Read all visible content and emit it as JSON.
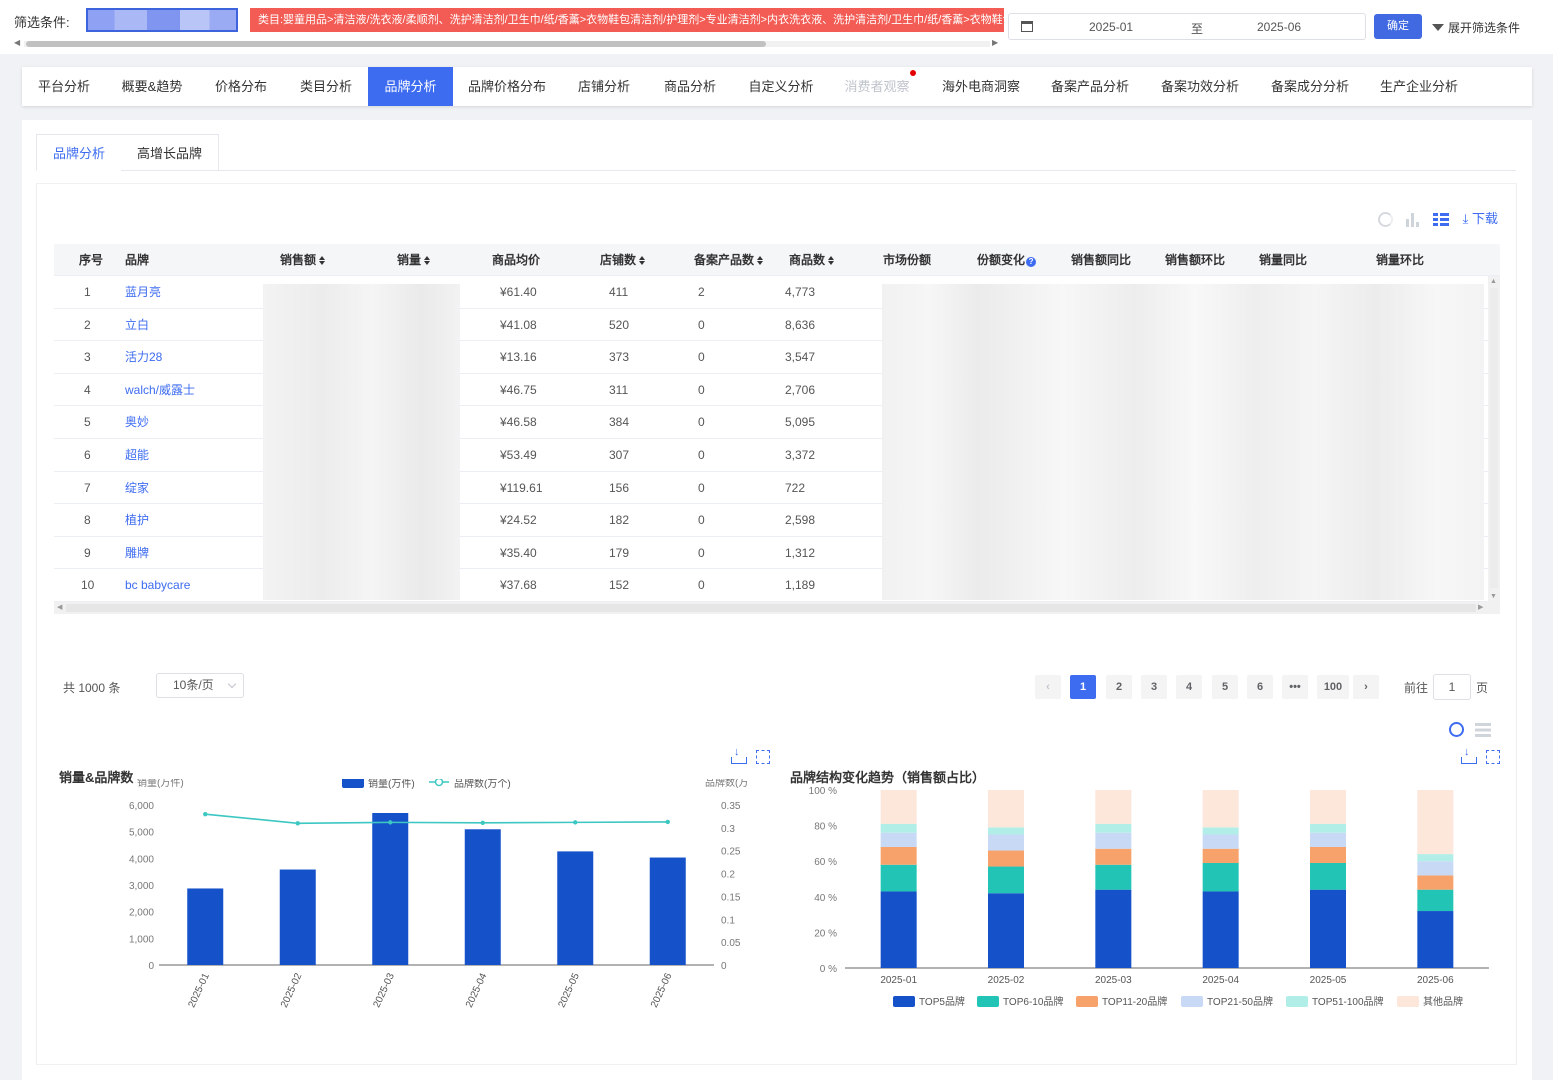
{
  "filter": {
    "label": "筛选条件:",
    "category_path": "类目:婴童用品>清洁液/洗衣液/柔顺剂、洗护清洁剂/卫生巾/纸/香薰>衣物鞋包清洁剂/护理剂>专业清洁剂>内衣洗衣液、洗护清洁剂/卫生巾/纸/香薰>衣物鞋包清洁",
    "date_start": "2025-01",
    "date_to": "至",
    "date_end": "2025-06",
    "confirm_label": "确定",
    "expand_label": "展开筛选条件"
  },
  "nav": {
    "tabs": [
      {
        "label": "平台分析"
      },
      {
        "label": "概要&趋势"
      },
      {
        "label": "价格分布"
      },
      {
        "label": "类目分析"
      },
      {
        "label": "品牌分析"
      },
      {
        "label": "品牌价格分布"
      },
      {
        "label": "店铺分析"
      },
      {
        "label": "商品分析"
      },
      {
        "label": "自定义分析"
      },
      {
        "label": "消费者观察"
      },
      {
        "label": "海外电商洞察"
      },
      {
        "label": "备案产品分析"
      },
      {
        "label": "备案功效分析"
      },
      {
        "label": "备案成分分析"
      },
      {
        "label": "生产企业分析"
      }
    ],
    "active": "品牌分析"
  },
  "subtabs": [
    {
      "label": "品牌分析"
    },
    {
      "label": "高增长品牌"
    }
  ],
  "toolbar": {
    "download_label": "下载"
  },
  "table": {
    "headers": {
      "idx": "序号",
      "brand": "品牌",
      "sales_amount": "销售额",
      "sales_volume": "销量",
      "avg_price": "商品均价",
      "shops": "店铺数",
      "filings": "备案产品数",
      "products": "商品数",
      "market_share": "市场份额",
      "share_change": "份额变化",
      "amount_yoy": "销售额同比",
      "amount_mom": "销售额环比",
      "volume_yoy": "销量同比",
      "volume_mom": "销量环比"
    },
    "rows": [
      {
        "idx": "1",
        "brand": "蓝月亮",
        "avg_price": "¥61.40",
        "shops": "411",
        "filings": "2",
        "products": "4,773"
      },
      {
        "idx": "2",
        "brand": "立白",
        "avg_price": "¥41.08",
        "shops": "520",
        "filings": "0",
        "products": "8,636"
      },
      {
        "idx": "3",
        "brand": "活力28",
        "avg_price": "¥13.16",
        "shops": "373",
        "filings": "0",
        "products": "3,547"
      },
      {
        "idx": "4",
        "brand": "walch/威露士",
        "avg_price": "¥46.75",
        "shops": "311",
        "filings": "0",
        "products": "2,706"
      },
      {
        "idx": "5",
        "brand": "奥妙",
        "avg_price": "¥46.58",
        "shops": "384",
        "filings": "0",
        "products": "5,095"
      },
      {
        "idx": "6",
        "brand": "超能",
        "avg_price": "¥53.49",
        "shops": "307",
        "filings": "0",
        "products": "3,372"
      },
      {
        "idx": "7",
        "brand": "绽家",
        "avg_price": "¥119.61",
        "shops": "156",
        "filings": "0",
        "products": "722"
      },
      {
        "idx": "8",
        "brand": "植护",
        "avg_price": "¥24.52",
        "shops": "182",
        "filings": "0",
        "products": "2,598"
      },
      {
        "idx": "9",
        "brand": "雕牌",
        "avg_price": "¥35.40",
        "shops": "179",
        "filings": "0",
        "products": "1,312"
      },
      {
        "idx": "10",
        "brand": "bc babycare",
        "avg_price": "¥37.68",
        "shops": "152",
        "filings": "0",
        "products": "1,189"
      }
    ]
  },
  "pagination": {
    "total_label": "共 1000 条",
    "page_size": "10条/页",
    "pages": [
      "1",
      "2",
      "3",
      "4",
      "5",
      "6",
      "•••",
      "100"
    ],
    "current": "1",
    "goto_prefix": "前往",
    "goto_value": "1",
    "goto_suffix": "页"
  },
  "chart_left_title": "销量&品牌数",
  "chart_right_title": "品牌结构变化趋势（销售额占比）",
  "chart_data": [
    {
      "type": "bar",
      "title": "销量&品牌数",
      "categories": [
        "2025-01",
        "2025-02",
        "2025-03",
        "2025-04",
        "2025-05",
        "2025-06"
      ],
      "series": [
        {
          "name": "销量(万件)",
          "type": "bar",
          "axis": "left",
          "color": "#1551c9",
          "values": [
            2870,
            3580,
            5700,
            5090,
            4260,
            4030
          ]
        },
        {
          "name": "品牌数(万个)",
          "type": "line",
          "axis": "right",
          "color": "#3cc7c2",
          "values": [
            0.33,
            0.31,
            0.312,
            0.311,
            0.312,
            0.313
          ]
        }
      ],
      "ylabel": "销量(万件)",
      "ylabel_right": "品牌数(万个)",
      "ylim": [
        0,
        6000
      ],
      "yticks": [
        "0",
        "1,000",
        "2,000",
        "3,000",
        "4,000",
        "5,000",
        "6,000"
      ],
      "ylim_right": [
        0,
        0.35
      ],
      "yticks_right": [
        "0",
        "0.05",
        "0.1",
        "0.15",
        "0.2",
        "0.25",
        "0.3",
        "0.35"
      ],
      "legend": "top-center"
    },
    {
      "type": "bar",
      "stacked": true,
      "title": "品牌结构变化趋势（销售额占比）",
      "categories": [
        "2025-01",
        "2025-02",
        "2025-03",
        "2025-04",
        "2025-05",
        "2025-06"
      ],
      "series": [
        {
          "name": "TOP5品牌",
          "color": "#1551c9",
          "values": [
            43,
            42,
            44,
            43,
            44,
            32
          ]
        },
        {
          "name": "TOP6-10品牌",
          "color": "#22c5b5",
          "values": [
            15,
            15,
            14,
            16,
            15,
            12
          ]
        },
        {
          "name": "TOP11-20品牌",
          "color": "#f7a26b",
          "values": [
            10,
            9,
            9,
            8,
            9,
            8
          ]
        },
        {
          "name": "TOP21-50品牌",
          "color": "#c8d9f6",
          "values": [
            8,
            9,
            9,
            8,
            8,
            8
          ]
        },
        {
          "name": "TOP51-100品牌",
          "color": "#b2eee8",
          "values": [
            5,
            4,
            5,
            4,
            5,
            4
          ]
        },
        {
          "name": "其他品牌",
          "color": "#fde6da",
          "values": [
            19,
            21,
            19,
            21,
            19,
            36
          ]
        }
      ],
      "ylim": [
        0,
        100
      ],
      "yticks": [
        "0 %",
        "20 %",
        "40 %",
        "60 %",
        "80 %",
        "100 %"
      ],
      "legend": "bottom-center"
    }
  ]
}
